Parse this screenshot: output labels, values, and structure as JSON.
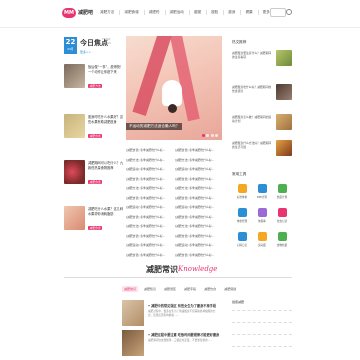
{
  "nav": {
    "logo_mark": "MM",
    "logo_text": "减肥吧",
    "items": [
      "减肥方法",
      "减肥食谱",
      "减肥药",
      "减肥运动",
      "瘦腿",
      "瘦脸",
      "瘦身",
      "健康",
      "更多"
    ]
  },
  "hot": {
    "day": "22",
    "month": "09月",
    "title": "今日焦点",
    "meta_top": "TODAY",
    "meta_bottom": "FOCUS",
    "link": "更多>>"
  },
  "left_items": [
    {
      "text": "饭后做“一事”，瘦得快！一个动作让你瘦下来",
      "tag": "减肥方法",
      "date": "2020-09-21"
    },
    {
      "text": "瘦身时吃什么水果好？这些水果有助减肥瘦身",
      "tag": "减肥食谱",
      "date": "2020-09-21"
    },
    {
      "text": "减肥期间可以吃什么？九款低热量食物推荐",
      "tag": "减肥食谱",
      "date": "2020-09-20"
    },
    {
      "text": "减肥吃什么水果？这几种水果帮你消耗脂肪",
      "tag": "减肥食谱",
      "date": "2020-09-20"
    }
  ],
  "hero": {
    "caption": "不运动的减肥方法适合懒人吗？"
  },
  "text_grid": [
    [
      "[减肥食谱] 冬季减肥吃什么好...",
      "[减肥食谱] 冬季减肥吃什么好..."
    ],
    [
      "[减肥方法] 冬季减肥吃什么好...",
      "[减肥方法] 冬季减肥吃什么好..."
    ],
    [
      "[减肥运动] 冬季减肥吃什么好...",
      "[减肥运动] 冬季减肥吃什么好..."
    ],
    [
      "[减肥食谱] 冬季减肥吃什么好...",
      "[减肥食谱] 冬季减肥吃什么好..."
    ],
    [
      "[减肥方法] 冬季减肥吃什么好...",
      "[减肥方法] 冬季减肥吃什么好..."
    ],
    [
      "[减肥食谱] 冬季减肥吃什么好...",
      "[减肥食谱] 冬季减肥吃什么好..."
    ],
    [
      "[减肥运动] 冬季减肥吃什么好...",
      "[减肥运动] 冬季减肥吃什么好..."
    ],
    [
      "[减肥食谱] 冬季减肥吃什么好...",
      "[减肥食谱] 冬季减肥吃什么好..."
    ],
    [
      "[减肥方法] 冬季减肥吃什么好...",
      "[减肥方法] 冬季减肥吃什么好..."
    ],
    [
      "[减肥食谱] 冬季减肥吃什么好...",
      "[减肥食谱] 冬季减肥吃什么好..."
    ],
    [
      "[减肥运动] 冬季减肥吃什么好...",
      "[减肥运动] 冬季减肥吃什么好..."
    ],
    [
      "[减肥食谱] 冬季减肥吃什么好...",
      "[减肥食谱] 冬季减肥吃什么好..."
    ]
  ],
  "side": {
    "title_top": "热文推荐",
    "items": [
      "减肥瘦身要注意什么？减肥期间的注意事项",
      "减肥瘦身吃什么好？减肥期间的饮食建议",
      "减肥瘦身怎么做？减肥期间的运动计划",
      "减肥瘦身什么方法好？减肥期间的生活习惯"
    ],
    "tools_title": "常用工具",
    "tools": [
      "标准体重",
      "BMI计算",
      "热量计算",
      "体重管理",
      "体脂率",
      "饮食记录",
      "心情日记",
      "运动量",
      "食物热量"
    ]
  },
  "knowledge": {
    "title_cn": "减肥常识",
    "title_en": "Knowledge",
    "tabs": [
      "减肥常识",
      "减肥知识",
      "减肥误区",
      "减肥手段",
      "减肥饮食",
      "减肥保健"
    ],
    "items": [
      {
        "title": "• 减肥中的常见误区 有些女生为了瘦身不择手段",
        "desc": "减肥过程中，很多女生为了快速瘦身不惜采取各种极端的方式，结果反而影响健康……"
      },
      {
        "title": "• 减肥过程中要注意 吃饭时间要规律才能更好瘦身",
        "desc": "减肥期间饮食要规律，三餐定时定量，不要暴饮暴食……"
      }
    ],
    "side_title": "健康减肥"
  },
  "colors": {
    "accent": "#e8346f",
    "blue": "#2c8fd6"
  }
}
